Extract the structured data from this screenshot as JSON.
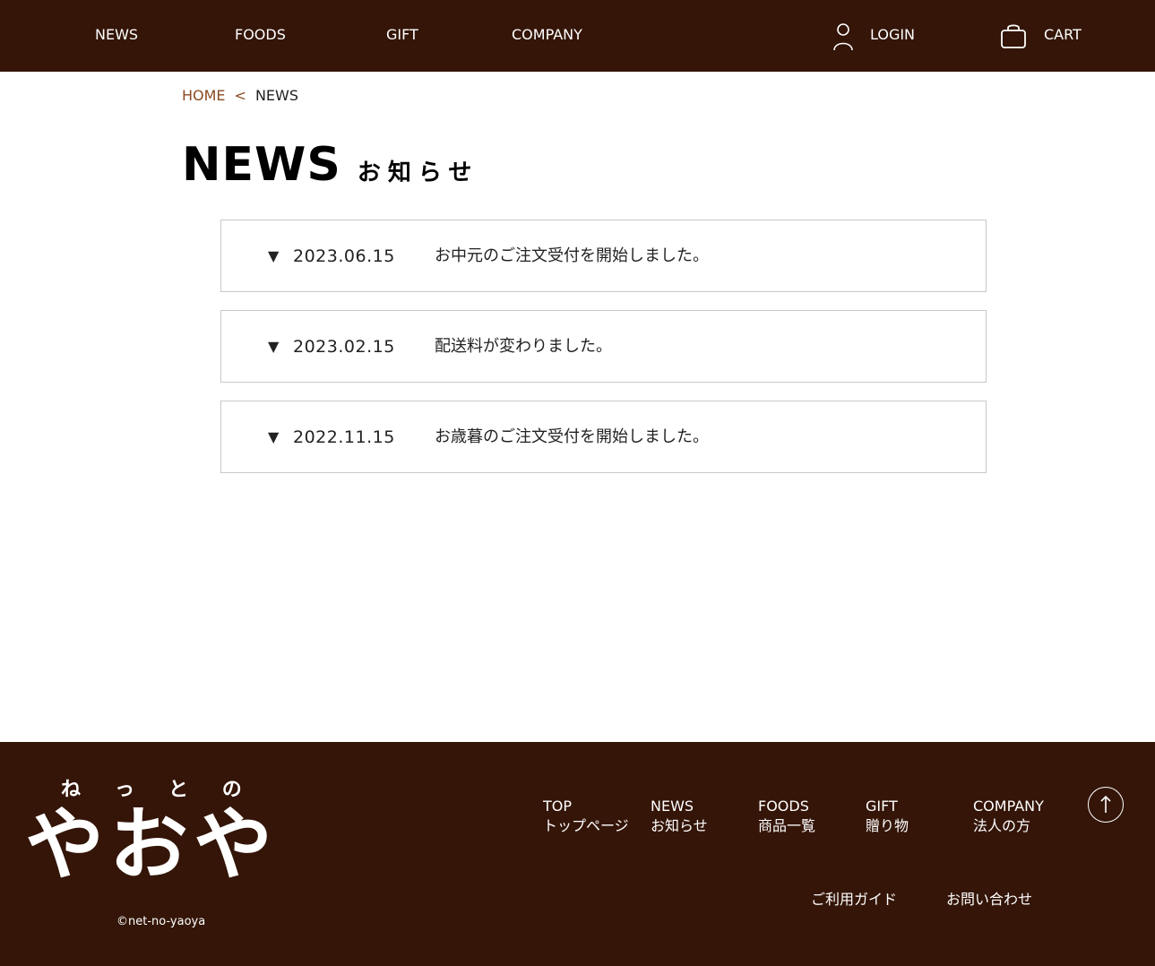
{
  "header": {
    "nav": [
      {
        "label": "NEWS"
      },
      {
        "label": "FOODS"
      },
      {
        "label": "GIFT"
      },
      {
        "label": "COMPANY"
      }
    ],
    "login_label": "LOGIN",
    "cart_label": "CART",
    "bg_color": "#341508"
  },
  "breadcrumb": {
    "home": "HOME",
    "separator": "<",
    "current": "NEWS"
  },
  "page_title": {
    "en": "NEWS",
    "ja": "お知らせ"
  },
  "news": [
    {
      "marker": "▼",
      "date": "2023.06.15",
      "text": "お中元のご注文受付を開始しました。"
    },
    {
      "marker": "▼",
      "date": "2023.02.15",
      "text": "配送料が変わりました。"
    },
    {
      "marker": "▼",
      "date": "2022.11.15",
      "text": "お歳暮のご注文受付を開始しました。"
    }
  ],
  "footer": {
    "logo_text_small": "ねっとの",
    "logo_text_large": "やおや",
    "copyright": "©net-no-yaoya",
    "nav": [
      {
        "en": "TOP",
        "ja": "トップページ"
      },
      {
        "en": "NEWS",
        "ja": "お知らせ"
      },
      {
        "en": "FOODS",
        "ja": "商品一覧"
      },
      {
        "en": "GIFT",
        "ja": "贈り物"
      },
      {
        "en": "COMPANY",
        "ja": "法人の方"
      }
    ],
    "sub_links": [
      {
        "label": "ご利用ガイド"
      },
      {
        "label": "お問い合わせ"
      }
    ],
    "to_top_icon": "arrow-up-icon"
  },
  "colors": {
    "brand_dark": "#341508",
    "breadcrumb_link": "#8a4a22",
    "border": "#c8c8c8"
  }
}
